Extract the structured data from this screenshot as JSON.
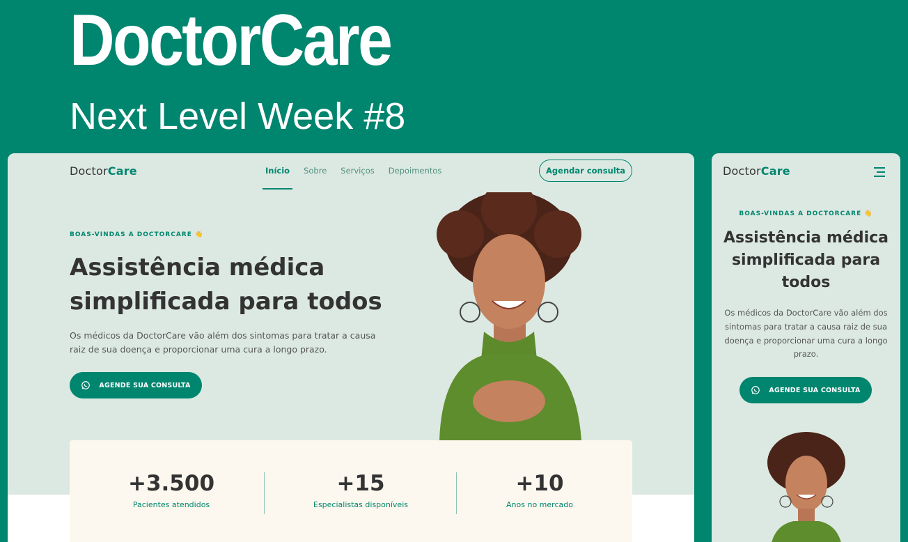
{
  "banner": {
    "title": "DoctorCare",
    "subtitle": "Next Level Week #8"
  },
  "site": {
    "logo_prefix": "Doctor",
    "logo_suffix": "Care",
    "nav": [
      "Início",
      "Sobre",
      "Serviços",
      "Depoimentos"
    ],
    "active_nav": "Início",
    "cta_outline": "Agendar consulta",
    "eyebrow": "BOAS-VINDAS A DOCTORCARE 👋",
    "headline": "Assistência médica simplificada para todos",
    "description": "Os médicos da DoctorCare vão além dos sintomas para tratar a causa raiz de sua doença e proporcionar uma cura a longo prazo.",
    "cta_fill": "AGENDE SUA CONSULTA"
  },
  "stats": [
    {
      "value": "+3.500",
      "label": "Pacientes atendidos"
    },
    {
      "value": "+15",
      "label": "Especialistas disponíveis"
    },
    {
      "value": "+10",
      "label": "Anos no mercado"
    }
  ],
  "colors": {
    "brand": "#00856F",
    "hero_bg": "#DCE9E2",
    "stats_bg": "#FDF8EF",
    "text": "#333333"
  },
  "icons": [
    "whatsapp-icon",
    "menu-icon"
  ]
}
